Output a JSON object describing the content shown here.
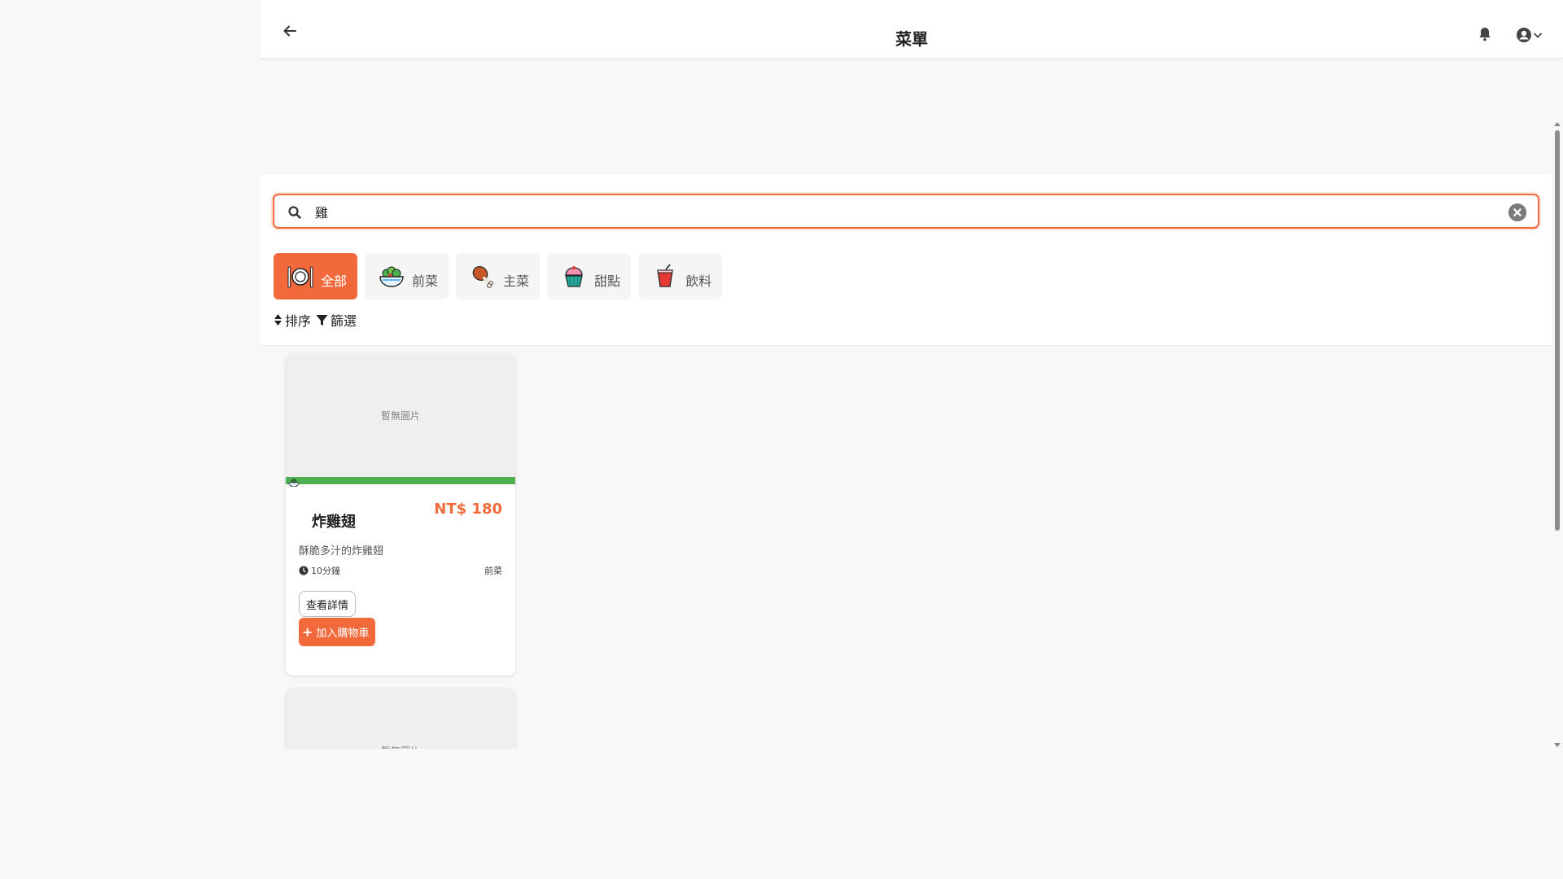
{
  "header": {
    "title": "菜單",
    "back_icon": "arrow-left-icon",
    "notification_icon": "bell-icon",
    "user_icon": "user-circle-icon"
  },
  "search": {
    "value": "雞",
    "placeholder": ""
  },
  "categories": [
    {
      "label": "全部",
      "icon": "plate-cutlery-icon",
      "active": true
    },
    {
      "label": "前菜",
      "icon": "salad-bowl-icon",
      "active": false
    },
    {
      "label": "主菜",
      "icon": "chicken-leg-icon",
      "active": false
    },
    {
      "label": "甜點",
      "icon": "cupcake-icon",
      "active": false
    },
    {
      "label": "飲料",
      "icon": "drink-cup-icon",
      "active": false
    }
  ],
  "tools": {
    "sort_label": "排序",
    "filter_label": "篩選"
  },
  "items": [
    {
      "image_placeholder": "暫無圖片",
      "name": "炸雞翅",
      "price": "NT$ 180",
      "description": "酥脆多汁的炸雞翅",
      "time": "10分鐘",
      "category": "前菜",
      "detail_label": "查看詳情",
      "cart_label": "加入購物車"
    },
    {
      "image_placeholder": "暫無圖片"
    }
  ],
  "colors": {
    "accent": "#f26a3c",
    "tag_bar": "#4caf50"
  }
}
